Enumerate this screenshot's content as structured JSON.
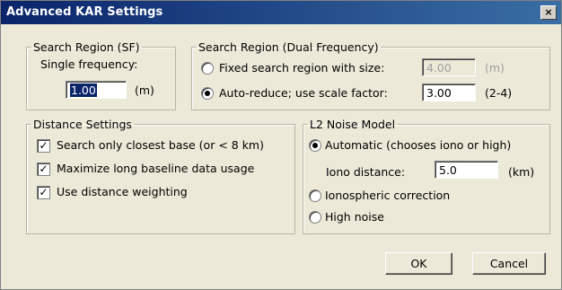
{
  "dialog": {
    "title": "Advanced KAR Settings",
    "close_glyph": "×"
  },
  "search_sf": {
    "legend": "Search Region (SF)",
    "label": "Single frequency:",
    "value": "1.00",
    "unit": "(m)"
  },
  "search_dual": {
    "legend": "Search Region (Dual Frequency)",
    "fixed_label": "Fixed search region with size:",
    "fixed_value": "4.00",
    "fixed_unit": "(m)",
    "fixed_selected": false,
    "auto_label": "Auto-reduce; use scale factor:",
    "auto_value": "3.00",
    "auto_range": "(2-4)",
    "auto_selected": true
  },
  "distance": {
    "legend": "Distance Settings",
    "items": [
      {
        "label": "Search only closest base (or < 8 km)",
        "checked": true
      },
      {
        "label": "Maximize long baseline data usage",
        "checked": true
      },
      {
        "label": "Use distance weighting",
        "checked": true
      }
    ]
  },
  "l2": {
    "legend": "L2 Noise Model",
    "automatic_label": "Automatic (chooses iono or high)",
    "automatic_selected": true,
    "iono_distance_label": "Iono distance:",
    "iono_distance_value": "5.0",
    "iono_distance_unit": "(km)",
    "ionospheric_label": "Ionospheric correction",
    "ionospheric_selected": false,
    "high_noise_label": "High noise",
    "high_noise_selected": false
  },
  "buttons": {
    "ok": "OK",
    "cancel": "Cancel"
  },
  "colors": {
    "titlebar_start": "#0a246a",
    "titlebar_end": "#3a6ea5",
    "dialog_bg": "#ece9d8"
  }
}
